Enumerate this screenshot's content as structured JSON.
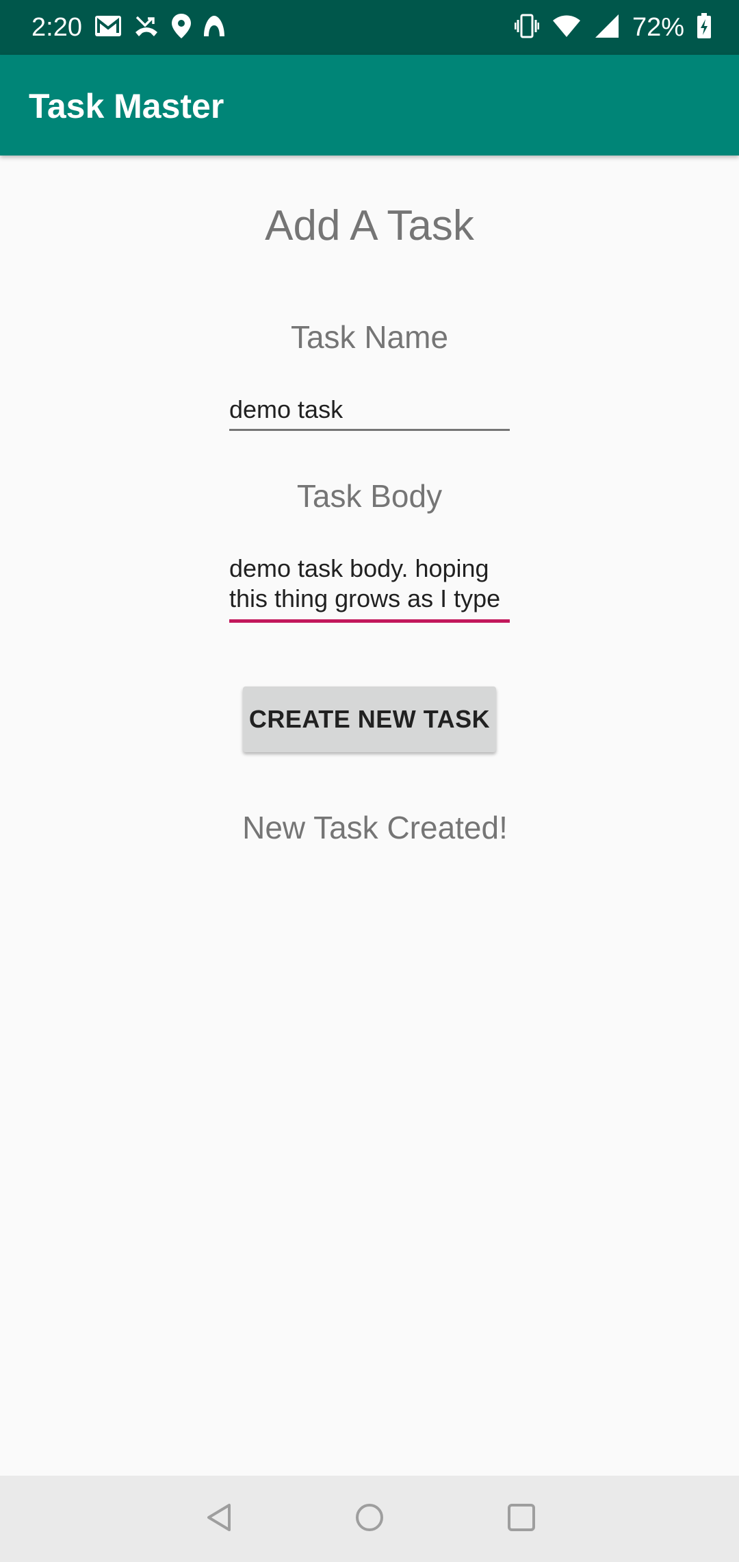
{
  "status_bar": {
    "time": "2:20",
    "battery_percent": "72%",
    "left_icons": [
      "gmail-icon",
      "missed-call-icon",
      "location-pin-icon",
      "app-notification-icon"
    ],
    "right_icons": [
      "vibrate-icon",
      "wifi-icon",
      "cellular-signal-icon",
      "battery-charging-icon"
    ],
    "background_color": "#00574b"
  },
  "app_bar": {
    "title": "Task Master",
    "background_color": "#008577"
  },
  "form": {
    "heading": "Add A Task",
    "task_name_label": "Task Name",
    "task_name_value": "demo task",
    "task_body_label": "Task Body",
    "task_body_lines": [
      "demo task body. hoping",
      "this thing grows as I type"
    ],
    "focus_accent_color": "#c2185b",
    "create_button_label": "CREATE NEW TASK",
    "result_message": "New Task Created!"
  },
  "nav_bar": {
    "buttons": [
      "back-icon",
      "home-icon",
      "recents-icon"
    ]
  }
}
